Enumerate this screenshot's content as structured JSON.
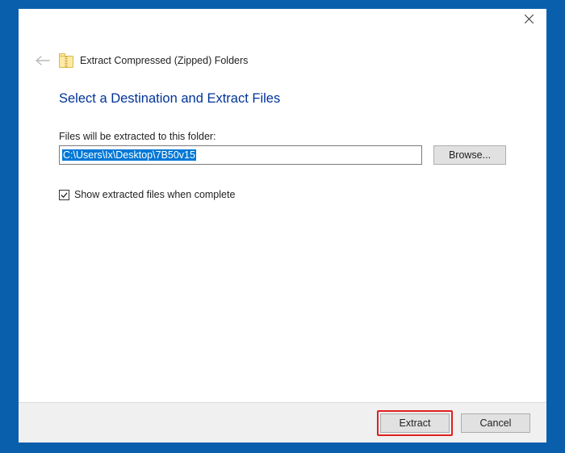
{
  "wizard": {
    "title": "Extract Compressed (Zipped) Folders",
    "heading": "Select a Destination and Extract Files",
    "path_label": "Files will be extracted to this folder:",
    "path_value": "C:\\Users\\Ix\\Desktop\\7B50v15",
    "browse_label": "Browse...",
    "show_files_label": "Show extracted files when complete",
    "show_files_checked": true,
    "extract_label": "Extract",
    "cancel_label": "Cancel"
  }
}
